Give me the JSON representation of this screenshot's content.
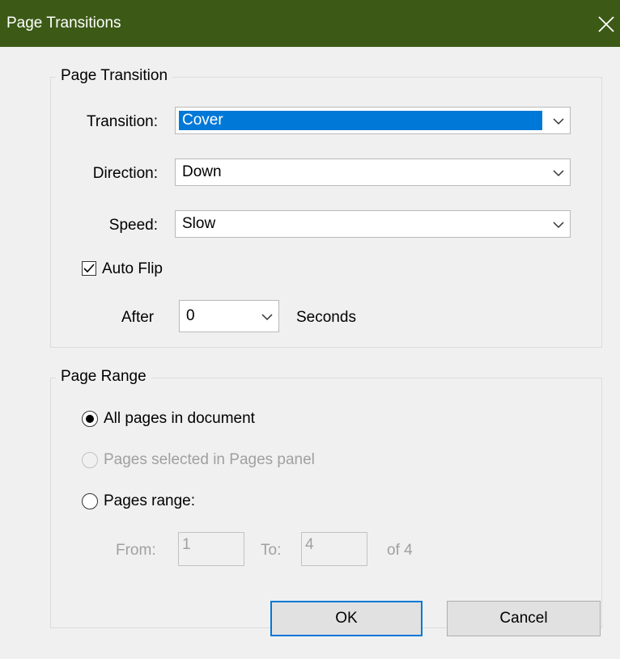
{
  "window": {
    "title": "Page Transitions"
  },
  "page_transition": {
    "legend": "Page Transition",
    "transition_label": "Transition:",
    "transition_value": "Cover",
    "direction_label": "Direction:",
    "direction_value": "Down",
    "speed_label": "Speed:",
    "speed_value": "Slow",
    "auto_flip_label": "Auto Flip",
    "auto_flip_checked": true,
    "after_label": "After",
    "after_value": "0",
    "seconds_label": "Seconds"
  },
  "page_range": {
    "legend": "Page Range",
    "all_pages_label": "All pages in document",
    "selected_pages_label": "Pages selected in Pages panel",
    "pages_range_label": "Pages range:",
    "from_label": "From:",
    "from_value": "1",
    "to_label": "To:",
    "to_value": "4",
    "of_label": "of 4"
  },
  "buttons": {
    "ok": "OK",
    "cancel": "Cancel"
  },
  "colors": {
    "titlebar": "#3c5a16",
    "selection": "#0078d7"
  }
}
